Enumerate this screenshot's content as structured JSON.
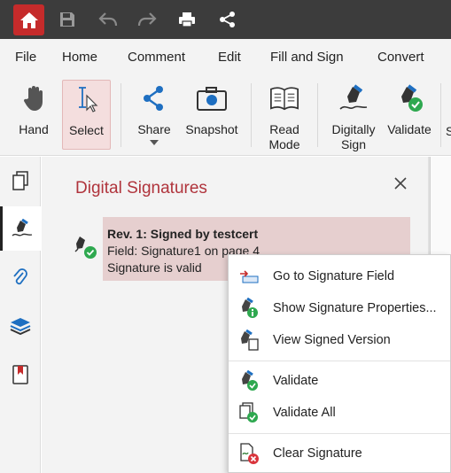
{
  "titlebar": {
    "icons": [
      "home-icon",
      "save-icon",
      "undo-icon",
      "redo-icon",
      "print-icon",
      "share-icon"
    ]
  },
  "menu": {
    "file": "File",
    "home": "Home",
    "comment": "Comment",
    "edit": "Edit",
    "fill_and_sign": "Fill and Sign",
    "convert": "Convert"
  },
  "ribbon": {
    "hand": "Hand",
    "select": "Select",
    "share": "Share",
    "snapshot": "Snapshot",
    "read_mode_1": "Read",
    "read_mode_2": "Mode",
    "digitally_sign_1": "Digitally",
    "digitally_sign_2": "Sign",
    "validate": "Validate",
    "cut_off": "S"
  },
  "panel": {
    "title": "Digital Signatures",
    "signature": {
      "title": "Rev. 1: Signed by testcert",
      "field": "Field: Signature1 on page 4",
      "status": "Signature is valid"
    }
  },
  "context_menu": {
    "items": [
      {
        "label": "Go to Signature Field",
        "icon": "signature-field-icon"
      },
      {
        "label": "Show Signature Properties...",
        "icon": "signature-properties-icon"
      },
      {
        "label": "View Signed Version",
        "icon": "signed-version-icon"
      },
      {
        "label": "Validate",
        "icon": "validate-icon"
      },
      {
        "label": "Validate All",
        "icon": "validate-all-icon"
      },
      {
        "label": "Clear Signature",
        "icon": "clear-signature-icon"
      }
    ]
  },
  "colors": {
    "accent": "#c52b2b",
    "title_red": "#b0343c",
    "selected_bg": "#e6cfcf",
    "valid_green": "#2ea84f",
    "error_red": "#d9343c"
  }
}
